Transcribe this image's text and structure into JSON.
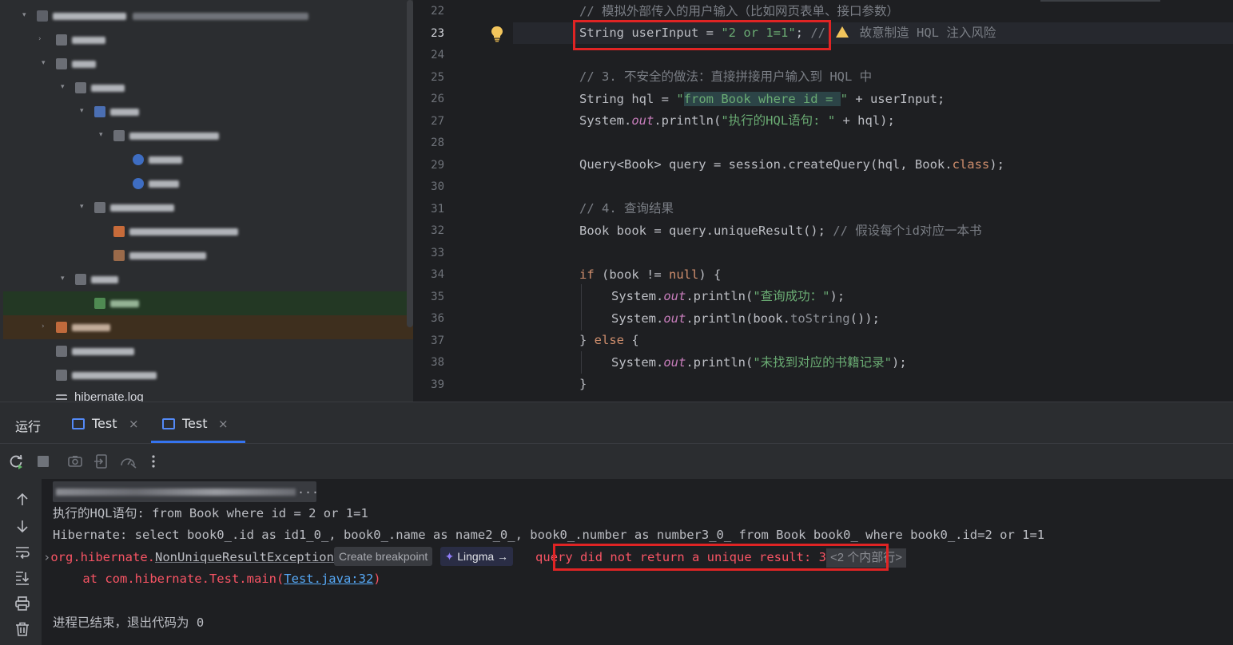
{
  "editor": {
    "line_numbers": [
      "22",
      "23",
      "24",
      "25",
      "26",
      "27",
      "28",
      "29",
      "30",
      "31",
      "32",
      "33",
      "34",
      "35",
      "36",
      "37",
      "38",
      "39"
    ],
    "active_line": "23",
    "lines": {
      "l22": {
        "comment": "// 模拟外部传入的用户输入（比如网页表单、接口参数）"
      },
      "l23": {
        "type": "String",
        "decl": " userInput = ",
        "value": "\"2 or 1=1\"",
        "semi": ";",
        "comment_pre": " // ",
        "comment_post": " 故意制造 HQL 注入风险"
      },
      "l25": {
        "comment": "// 3. 不安全的做法：直接拼接用户输入到 HQL 中"
      },
      "l26": {
        "type": "String",
        "decl": " hql = ",
        "q_open": "\"",
        "str_hl": "from Book where id = ",
        "q_close": "\"",
        "rest": " + userInput;"
      },
      "l27": {
        "obj": "System.",
        "field": "out",
        "call": ".println(",
        "str": "\"执行的HQL语句: \"",
        "rest": " + hql);"
      },
      "l29": {
        "pre": "Query<Book> query = session.createQuery(hql, Book.",
        "kw": "class",
        "post": ");"
      },
      "l31": {
        "comment": "// 4. 查询结果"
      },
      "l32": {
        "code": "Book book = query.uniqueResult(); ",
        "comment": "// 假设每个id对应一本书"
      },
      "l34": {
        "kw": "if",
        "pre": " (book != ",
        "null_kw": "null",
        "post": ") {"
      },
      "l35": {
        "obj": "System.",
        "field": "out",
        "call": ".println(",
        "str": "\"查询成功：\"",
        "rest": ");"
      },
      "l36": {
        "obj": "System.",
        "field": "out",
        "call": ".println(book.",
        "method": "toString",
        "rest": "());"
      },
      "l37": {
        "pre": "} ",
        "kw": "else",
        "post": " {"
      },
      "l38": {
        "obj": "System.",
        "field": "out",
        "call": ".println(",
        "str": "\"未找到对应的书籍记录\"",
        "rest": ");"
      },
      "l39": {
        "code": "}"
      }
    }
  },
  "project_tree": {
    "last_item": "hibernate.log"
  },
  "run_panel": {
    "title": "运行",
    "tabs": [
      {
        "label": "Test",
        "close": "×"
      },
      {
        "label": "Test",
        "close": "×"
      }
    ],
    "console": {
      "path_ellipsis": "...",
      "hql_line": "执行的HQL语句: from Book where id = 2 or 1=1",
      "sql_line": "Hibernate: select book0_.id as id1_0_, book0_.name as name2_0_, book0_.number as number3_0_ from Book book0_ where book0_.id=2 or 1=1",
      "exc_pkg": "org.hibernate.",
      "exc_class": "NonUniqueResultException",
      "create_breakpoint": "Create breakpoint",
      "lingma": "Lingma →",
      "exc_message": " query did not return a unique result: 3",
      "internal_frames": "<2 个内部行>",
      "at_prefix": "    at com.hibernate.Test.main(",
      "at_link": "Test.java:32",
      "at_suffix": ")",
      "exit_line": "进程已结束，退出代码为 0"
    }
  },
  "colors": {
    "error_red": "#f75464",
    "annotation_red": "#e02424",
    "accent_blue": "#3574f0"
  }
}
